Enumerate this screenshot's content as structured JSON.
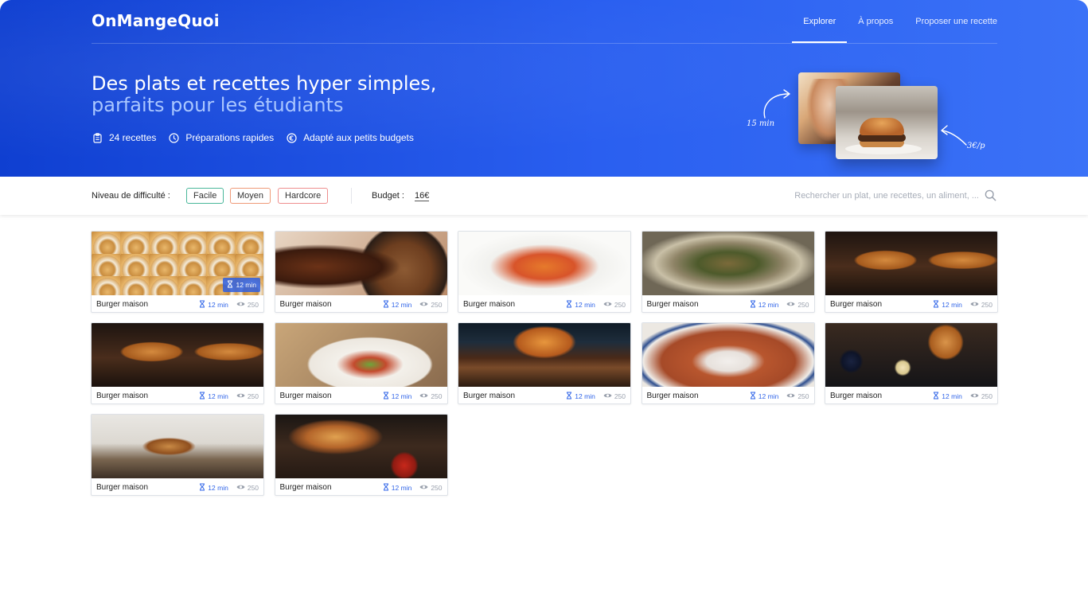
{
  "header": {
    "logo": "OnMangeQuoi",
    "nav": [
      {
        "label": "Explorer",
        "active": true
      },
      {
        "label": "À propos",
        "active": false
      },
      {
        "label": "Proposer une recette",
        "active": false
      }
    ]
  },
  "hero": {
    "title_line1": "Des plats et recettes hyper simples,",
    "title_line2": "parfaits pour les étudiants",
    "features": [
      {
        "icon": "clipboard-icon",
        "label": "24 recettes"
      },
      {
        "icon": "clock-icon",
        "label": "Préparations rapides"
      },
      {
        "icon": "euro-icon",
        "label": "Adapté aux petits budgets"
      }
    ],
    "annotation_time": "15 min",
    "annotation_price": "3€/p"
  },
  "filters": {
    "difficulty_label": "Niveau de difficulté :",
    "difficulties": [
      "Facile",
      "Moyen",
      "Hardcore"
    ],
    "budget_label": "Budget :",
    "budget_value": "16€",
    "search_placeholder": "Rechercher un plat, une recettes, un aliment, ..."
  },
  "cards": [
    {
      "title": "Burger maison",
      "time": "12 min",
      "views": "250",
      "hover_badge": "12 min"
    },
    {
      "title": "Burger maison",
      "time": "12 min",
      "views": "250"
    },
    {
      "title": "Burger maison",
      "time": "12 min",
      "views": "250"
    },
    {
      "title": "Burger maison",
      "time": "12 min",
      "views": "250"
    },
    {
      "title": "Burger maison",
      "time": "12 min",
      "views": "250"
    },
    {
      "title": "Burger maison",
      "time": "12 min",
      "views": "250"
    },
    {
      "title": "Burger maison",
      "time": "12 min",
      "views": "250"
    },
    {
      "title": "Burger maison",
      "time": "12 min",
      "views": "250"
    },
    {
      "title": "Burger maison",
      "time": "12 min",
      "views": "250"
    },
    {
      "title": "Burger maison",
      "time": "12 min",
      "views": "250"
    },
    {
      "title": "Burger maison",
      "time": "12 min",
      "views": "250"
    },
    {
      "title": "Burger maison",
      "time": "12 min",
      "views": "250"
    }
  ],
  "colors": {
    "brand_blue": "#2a5ff0",
    "accent_time": "#2f64e8",
    "easy": "#49b79a",
    "medium": "#ef9a78",
    "hard": "#ee8e8e"
  }
}
